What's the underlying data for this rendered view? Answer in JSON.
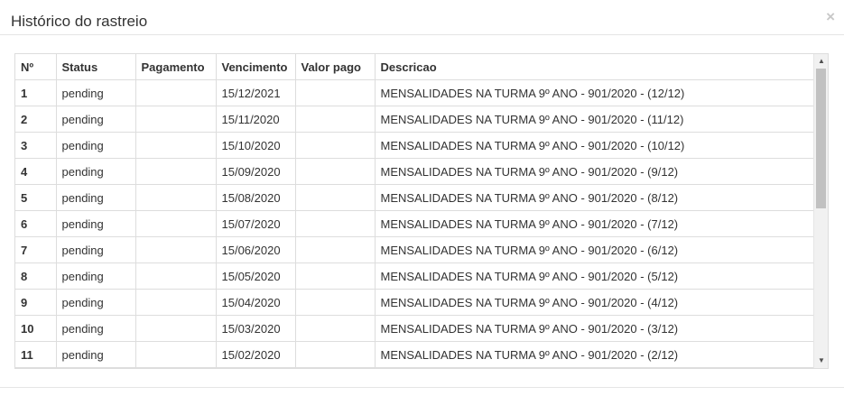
{
  "modal": {
    "title": "Histórico do rastreio",
    "close_label": "×"
  },
  "table": {
    "headers": {
      "num": "Nº",
      "status": "Status",
      "pagamento": "Pagamento",
      "vencimento": "Vencimento",
      "valor_pago": "Valor pago",
      "descricao": "Descricao"
    },
    "rows": [
      {
        "num": "1",
        "status": "pending",
        "pagamento": "",
        "vencimento": "15/12/2021",
        "valor_pago": "",
        "descricao": "MENSALIDADES NA TURMA 9º ANO - 901/2020 - (12/12)"
      },
      {
        "num": "2",
        "status": "pending",
        "pagamento": "",
        "vencimento": "15/11/2020",
        "valor_pago": "",
        "descricao": "MENSALIDADES NA TURMA 9º ANO - 901/2020 - (11/12)"
      },
      {
        "num": "3",
        "status": "pending",
        "pagamento": "",
        "vencimento": "15/10/2020",
        "valor_pago": "",
        "descricao": "MENSALIDADES NA TURMA 9º ANO - 901/2020 - (10/12)"
      },
      {
        "num": "4",
        "status": "pending",
        "pagamento": "",
        "vencimento": "15/09/2020",
        "valor_pago": "",
        "descricao": "MENSALIDADES NA TURMA 9º ANO - 901/2020 - (9/12)"
      },
      {
        "num": "5",
        "status": "pending",
        "pagamento": "",
        "vencimento": "15/08/2020",
        "valor_pago": "",
        "descricao": "MENSALIDADES NA TURMA 9º ANO - 901/2020 - (8/12)"
      },
      {
        "num": "6",
        "status": "pending",
        "pagamento": "",
        "vencimento": "15/07/2020",
        "valor_pago": "",
        "descricao": "MENSALIDADES NA TURMA 9º ANO - 901/2020 - (7/12)"
      },
      {
        "num": "7",
        "status": "pending",
        "pagamento": "",
        "vencimento": "15/06/2020",
        "valor_pago": "",
        "descricao": "MENSALIDADES NA TURMA 9º ANO - 901/2020 - (6/12)"
      },
      {
        "num": "8",
        "status": "pending",
        "pagamento": "",
        "vencimento": "15/05/2020",
        "valor_pago": "",
        "descricao": "MENSALIDADES NA TURMA 9º ANO - 901/2020 - (5/12)"
      },
      {
        "num": "9",
        "status": "pending",
        "pagamento": "",
        "vencimento": "15/04/2020",
        "valor_pago": "",
        "descricao": "MENSALIDADES NA TURMA 9º ANO - 901/2020 - (4/12)"
      },
      {
        "num": "10",
        "status": "pending",
        "pagamento": "",
        "vencimento": "15/03/2020",
        "valor_pago": "",
        "descricao": "MENSALIDADES NA TURMA 9º ANO - 901/2020 - (3/12)"
      },
      {
        "num": "11",
        "status": "pending",
        "pagamento": "",
        "vencimento": "15/02/2020",
        "valor_pago": "",
        "descricao": "MENSALIDADES NA TURMA 9º ANO - 901/2020 - (2/12)"
      }
    ]
  },
  "scrollbar": {
    "up_icon": "triangle-up-icon",
    "down_icon": "triangle-down-icon"
  }
}
